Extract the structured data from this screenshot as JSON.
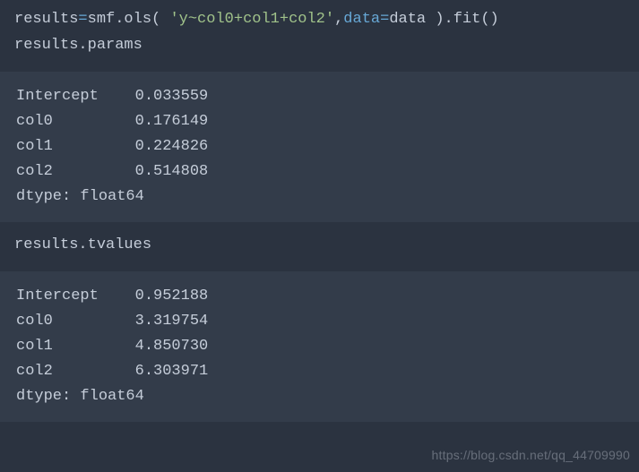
{
  "code1": {
    "line1": {
      "p1": "results",
      "p2": "=",
      "p3": "smf.ols( ",
      "p4": "'y~col0+col1+col2'",
      "p5": ",",
      "p6": "data",
      "p7": "=",
      "p8": "data ).fit()"
    },
    "line2": "results.params"
  },
  "out1": {
    "l1": "Intercept    0.033559",
    "l2": "col0         0.176149",
    "l3": "col1         0.224826",
    "l4": "col2         0.514808",
    "l5": "dtype: float64"
  },
  "code2": {
    "line1": "results.tvalues"
  },
  "out2": {
    "l1": "Intercept    0.952188",
    "l2": "col0         3.319754",
    "l3": "col1         4.850730",
    "l4": "col2         6.303971",
    "l5": "dtype: float64"
  },
  "watermark": "https://blog.csdn.net/qq_44709990"
}
